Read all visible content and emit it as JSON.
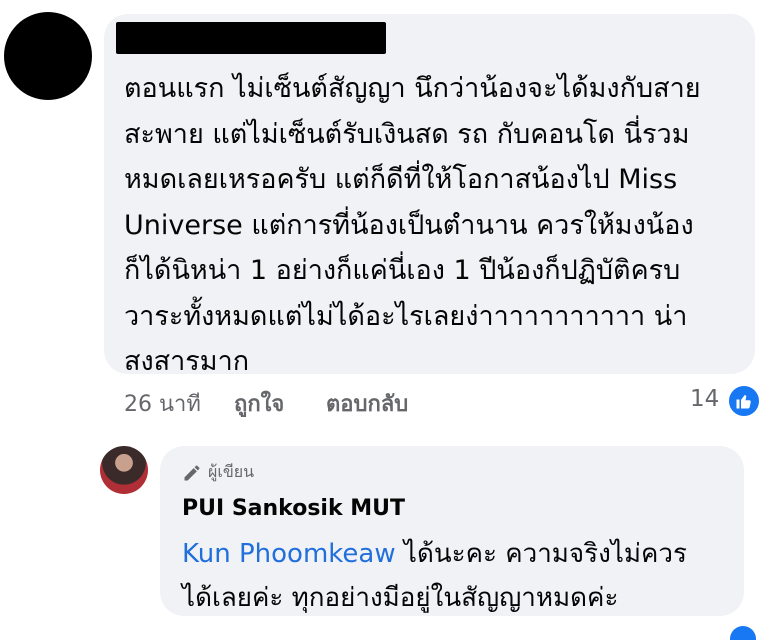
{
  "comment": {
    "text": "ตอนแรก ไม่เซ็นต์สัญญา นึกว่าน้องจะได้มงกับสาย\nสะพาย แต่ไม่เซ็นต์รับเงินสด รถ กับคอนโด นี่รวม\nหมดเลยเหรอครับ แต่ก็ดีที่ให้โอกาสน้องไป Miss\nUniverse แต่การที่น้องเป็นตำนาน ควรให้มงน้อง\nก็ได้นิหน่า 1 อย่างก็แค่นี่เอง 1 ปีน้องก็ปฏิบัติครบ\nวาระทั้งหมดแต่ไม่ได้อะไรเลยง่าาาาาาาาาาา น่า\nสงสารมาก",
    "time": "26 นาที",
    "like_label": "ถูกใจ",
    "reply_label": "ตอบกลับ",
    "reaction_count": "14"
  },
  "reply": {
    "badge": "ผู้เขียน",
    "author": "PUI Sankosik MUT",
    "mention": "Kun Phoomkeaw",
    "text": " ได้นะคะ ความจริงไม่ควร\nได้เลยค่ะ ทุกอย่างมีอยู่ในสัญญาหมดค่ะ"
  },
  "colors": {
    "bubble": "#f0f2f5",
    "mention": "#216fdb",
    "like_blue": "#1877f2",
    "meta_gray": "#65676b"
  }
}
